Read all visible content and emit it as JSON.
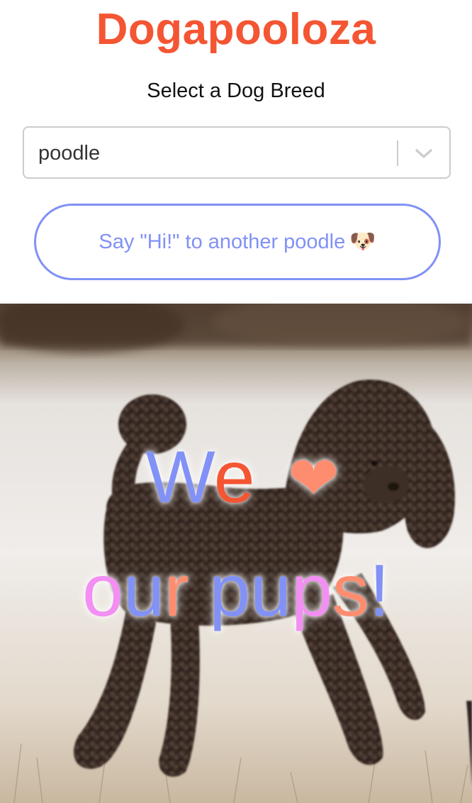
{
  "app": {
    "title": "Dogapooloza"
  },
  "breed_picker": {
    "label": "Select a Dog Breed",
    "selected_value": "poodle"
  },
  "actions": {
    "say_hi_label": "Say \"Hi!\" to another poodle",
    "say_hi_emoji": "🐶"
  },
  "hero": {
    "image_alt": "poodle",
    "slogan_line1": [
      "W",
      "e",
      " ",
      "❤"
    ],
    "slogan_line2": [
      "o",
      "u",
      "r",
      " ",
      "p",
      "u",
      "p",
      "s",
      "!"
    ]
  },
  "colors": {
    "brand_orange": "#f45533",
    "brand_blue": "#8191f6",
    "brand_pink": "#f28ff2",
    "heart": "#fe8d70"
  }
}
